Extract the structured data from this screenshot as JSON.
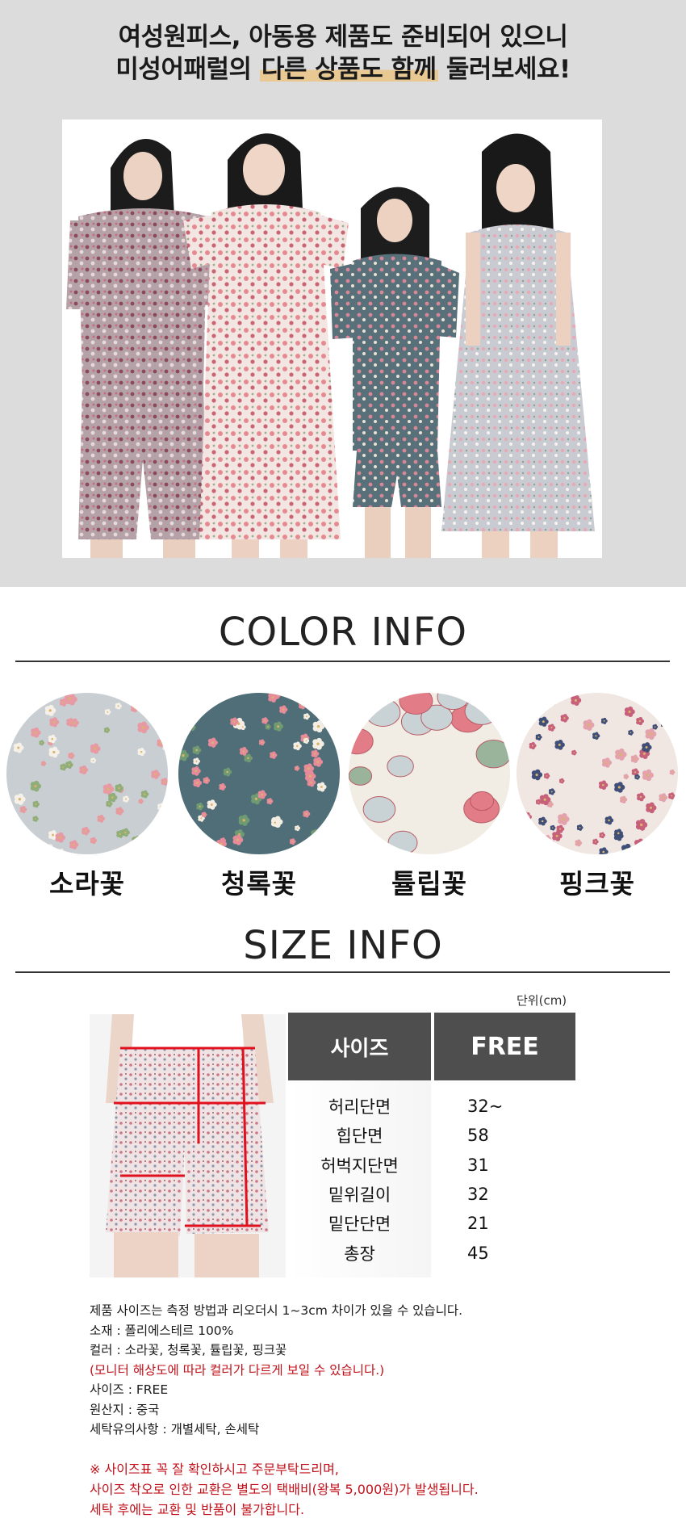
{
  "banner": {
    "line1": "여성원피스, 아동용 제품도 준비되어 있으니",
    "line2_pre": "미성어패럴의 ",
    "line2_hl": "다른 상품도 함께",
    "line2_post": " 둘러보세요!"
  },
  "colors": {
    "title": "COLOR INFO",
    "swatches": [
      {
        "label": "소라꽃",
        "bg": "#c9ced2",
        "flower": "#e79aa3",
        "accent": "#f6f1e8",
        "leaf": "#8fae7a"
      },
      {
        "label": "청록꽃",
        "bg": "#4f6e78",
        "flower": "#e78a99",
        "accent": "#f3ede3",
        "leaf": "#6f9a72"
      },
      {
        "label": "튤립꽃",
        "bg": "#f1ede4",
        "flower": "#e27c86",
        "accent": "#c9d3d6",
        "leaf": "#9ab39b"
      },
      {
        "label": "핑크꽃",
        "bg": "#f0e6e2",
        "flower": "#c7607a",
        "accent": "#3f4f77",
        "leaf": "#e3a2ac"
      }
    ]
  },
  "size": {
    "title": "SIZE INFO",
    "unit": "단위(cm)",
    "header_label": "사이즈",
    "header_value": "FREE",
    "rows": [
      {
        "k": "허리단면",
        "v": "32~"
      },
      {
        "k": "힙단면",
        "v": "58"
      },
      {
        "k": "허벅지단면",
        "v": "31"
      },
      {
        "k": "밑위길이",
        "v": "32"
      },
      {
        "k": "밑단단면",
        "v": "21"
      },
      {
        "k": "총장",
        "v": "45"
      }
    ]
  },
  "notes": [
    {
      "text": "제품 사이즈는 측정 방법과 리오더시 1~3cm  차이가 있을 수 있습니다.",
      "red": false
    },
    {
      "text": "소재 : 폴리에스테르 100%",
      "red": false
    },
    {
      "text": "컬러 : 소라꽃, 청록꽃, 튤립꽃, 핑크꽃",
      "red": false
    },
    {
      "text": "(모니터 해상도에 따라 컬러가 다르게 보일 수 있습니다.)",
      "red": true
    },
    {
      "text": "사이즈 :  FREE",
      "red": false
    },
    {
      "text": "원산지 :  중국",
      "red": false
    },
    {
      "text": "세탁유의사항 : 개별세탁, 손세탁",
      "red": false
    }
  ],
  "warnings": [
    "※ 사이즈표 꼭 잘 확인하시고 주문부탁드리며,",
    "사이즈 착오로 인한 교환은 별도의 택배비(왕복 5,000원)가 발생됩니다.",
    "세탁 후에는 교환 및 반품이 불가합니다."
  ]
}
